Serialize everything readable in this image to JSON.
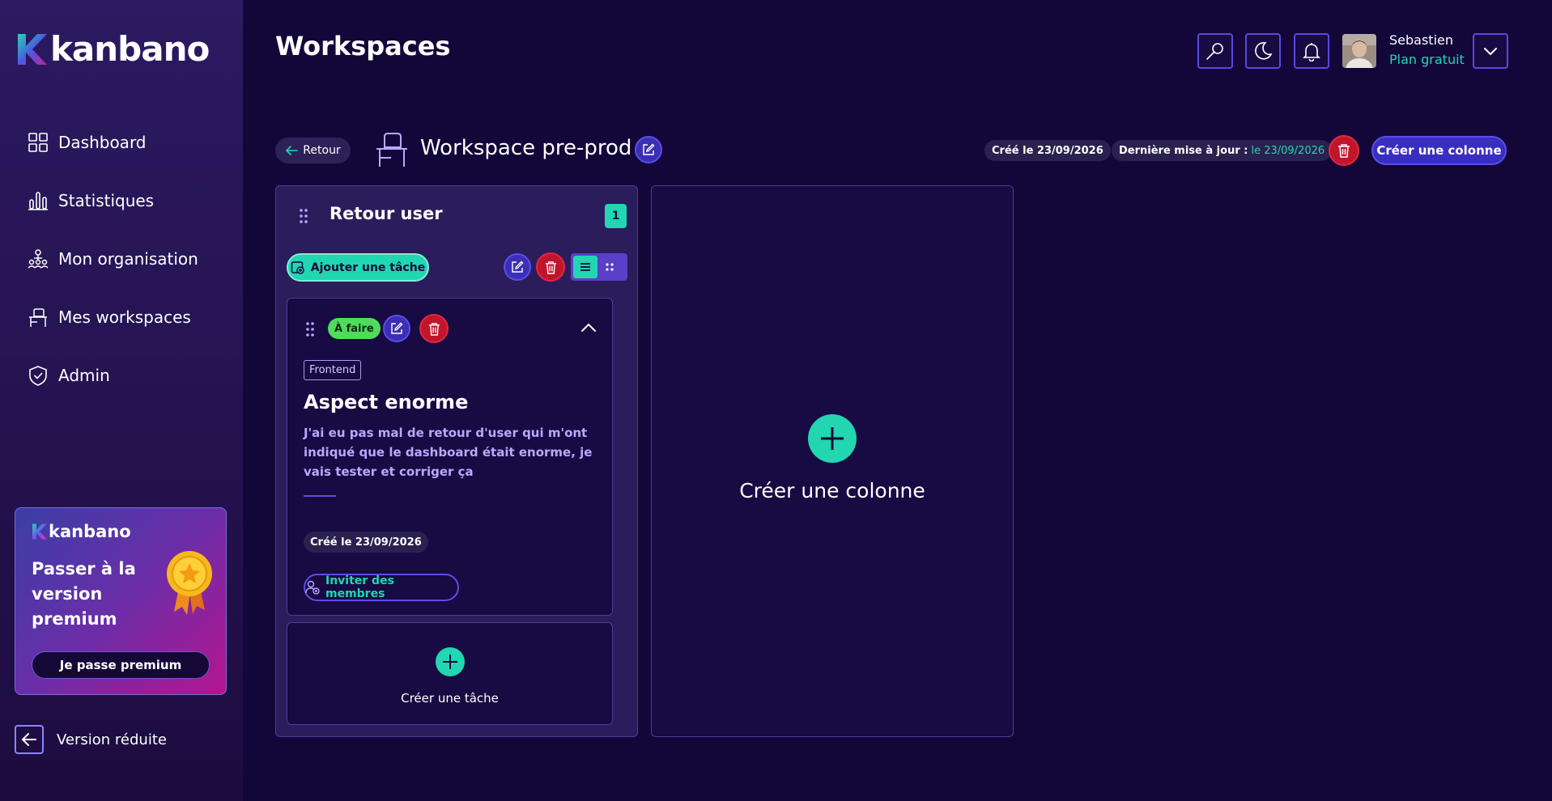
{
  "app": {
    "logo_text": "kanbano",
    "accent": "#21d6b0",
    "brand": "#5a4ee8",
    "danger": "#c0152a"
  },
  "sidebar": {
    "items": [
      {
        "label": "Dashboard",
        "icon": "grid-icon"
      },
      {
        "label": "Statistiques",
        "icon": "bar-chart-icon"
      },
      {
        "label": "Mon organisation",
        "icon": "org-chart-icon"
      },
      {
        "label": "Mes workspaces",
        "icon": "desk-icon"
      },
      {
        "label": "Admin",
        "icon": "shield-icon"
      }
    ],
    "promo": {
      "logo_text": "kanbano",
      "title": "Passer à la version premium",
      "button": "Je passe premium"
    },
    "collapse_label": "Version réduite"
  },
  "header": {
    "title": "Workspaces",
    "user_name": "Sebastien",
    "user_plan": "Plan gratuit"
  },
  "workspace": {
    "back_label": "Retour",
    "name": "Workspace pre-prod",
    "created_label": "Créé le 23/09/2026",
    "updated_prefix": "Dernière mise à jour :",
    "updated_value": "le 23/09/2026",
    "create_column_label": "Créer une colonne"
  },
  "column": {
    "title": "Retour user",
    "count": "1",
    "add_task_label": "Ajouter une tâche",
    "card": {
      "status": "À faire",
      "tag": "Frontend",
      "title": "Aspect enorme",
      "description": "J'ai eu pas mal de retour d'user qui m'ont indiqué que le dashboard était enorme, je vais tester et corriger ça",
      "created": "Créé le 23/09/2026",
      "invite_label": "Inviter des membres"
    },
    "create_task_label": "Créer une tâche"
  },
  "new_column": {
    "label": "Créer une colonne"
  }
}
